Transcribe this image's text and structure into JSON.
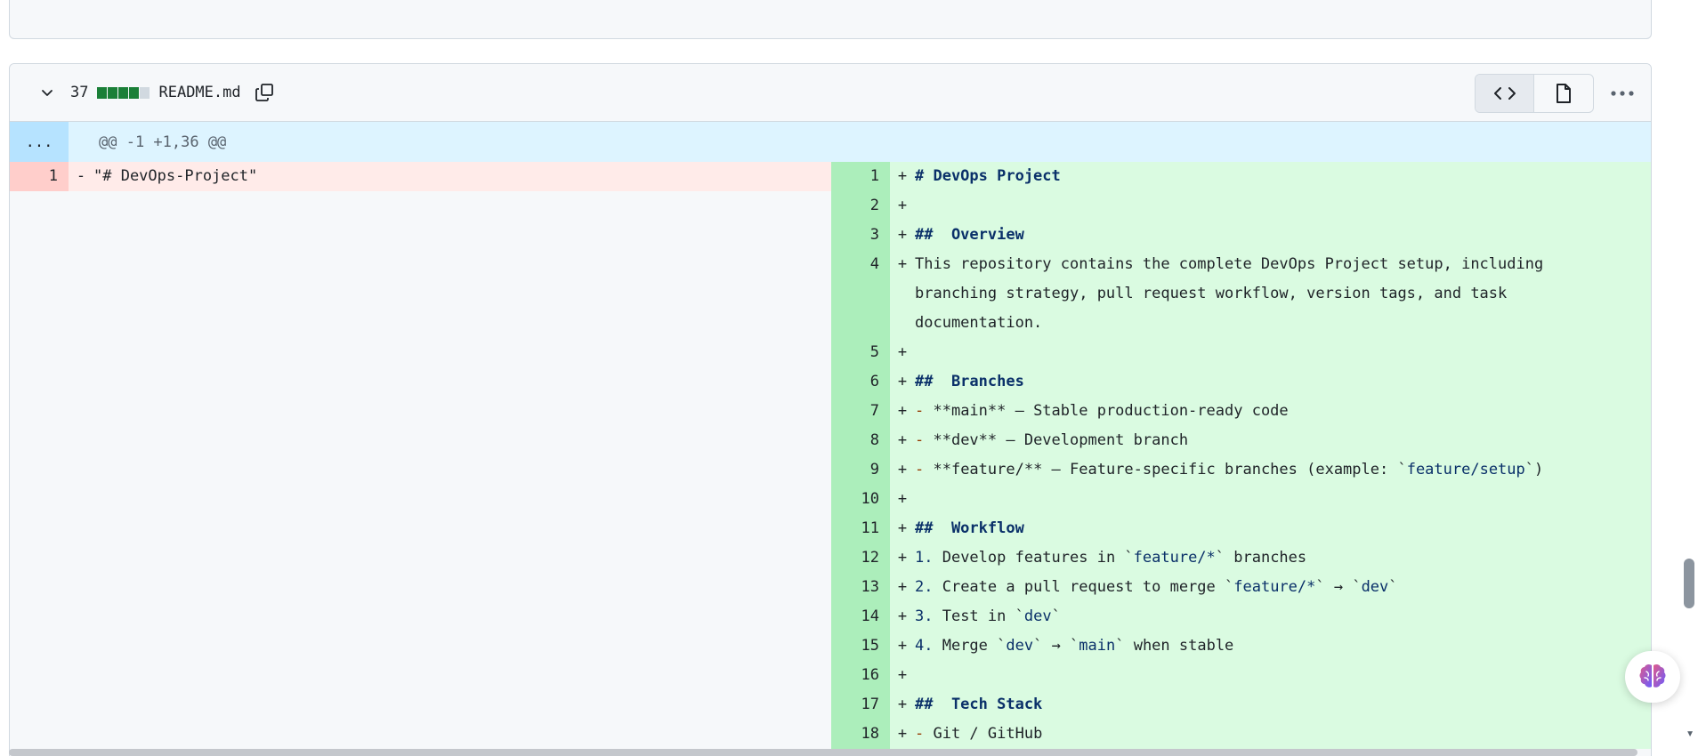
{
  "file": {
    "changes_count": "37",
    "diffstat": [
      "#1a7f37",
      "#1a7f37",
      "#1a7f37",
      "#1a7f37",
      "#d1d9e0"
    ],
    "name": "README.md"
  },
  "hunk": {
    "expand_label": "...",
    "header": "@@ -1 +1,36 @@"
  },
  "left": [
    {
      "num": "1",
      "marker": "-",
      "text": "\"# DevOps-Project\""
    }
  ],
  "right": [
    {
      "num": "1",
      "marker": "+",
      "text": "# DevOps Project"
    },
    {
      "num": "2",
      "marker": "+",
      "text": ""
    },
    {
      "num": "3",
      "marker": "+",
      "text": "##  Overview"
    },
    {
      "num": "4",
      "marker": "+",
      "text": "This repository contains the complete DevOps Project setup, including branching strategy, pull request workflow, version tags, and task documentation."
    },
    {
      "num": "5",
      "marker": "+",
      "text": ""
    },
    {
      "num": "6",
      "marker": "+",
      "text": "##  Branches"
    },
    {
      "num": "7",
      "marker": "+",
      "text": "- **main** – Stable production-ready code"
    },
    {
      "num": "8",
      "marker": "+",
      "text": "- **dev** – Development branch"
    },
    {
      "num": "9",
      "marker": "+",
      "text": "- **feature/** – Feature-specific branches (example: `feature/setup`)"
    },
    {
      "num": "10",
      "marker": "+",
      "text": ""
    },
    {
      "num": "11",
      "marker": "+",
      "text": "##  Workflow"
    },
    {
      "num": "12",
      "marker": "+",
      "text": "1. Develop features in `feature/*` branches"
    },
    {
      "num": "13",
      "marker": "+",
      "text": "2. Create a pull request to merge `feature/*` → `dev`"
    },
    {
      "num": "14",
      "marker": "+",
      "text": "3. Test in `dev`"
    },
    {
      "num": "15",
      "marker": "+",
      "text": "4. Merge `dev` → `main` when stable"
    },
    {
      "num": "16",
      "marker": "+",
      "text": ""
    },
    {
      "num": "17",
      "marker": "+",
      "text": "##  Tech Stack"
    },
    {
      "num": "18",
      "marker": "+",
      "text": "- Git / GitHub"
    }
  ],
  "icons": {
    "collapse": "chevron-down-icon",
    "copy": "copy-icon",
    "code_view": "code-icon",
    "file_view": "file-icon",
    "more": "kebab-horizontal-icon",
    "assistant": "brain-icon"
  }
}
